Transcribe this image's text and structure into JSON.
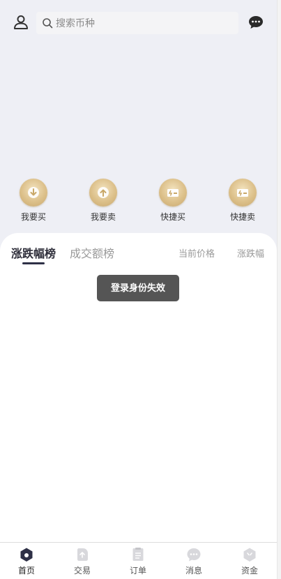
{
  "header": {
    "search_placeholder": "搜索币种"
  },
  "actions": [
    {
      "label": "我要买",
      "icon": "buy-arrow-down-icon"
    },
    {
      "label": "我要卖",
      "icon": "sell-arrow-up-icon"
    },
    {
      "label": "快捷买",
      "icon": "quick-buy-card-icon"
    },
    {
      "label": "快捷卖",
      "icon": "quick-sell-card-icon"
    }
  ],
  "rank_tabs": [
    "涨跌幅榜",
    "成交额榜"
  ],
  "columns": {
    "price": "当前价格",
    "change": "涨跌幅"
  },
  "toast": "登录身份失效",
  "tabbar": [
    {
      "label": "首页",
      "icon": "home-icon",
      "active": true
    },
    {
      "label": "交易",
      "icon": "trade-icon"
    },
    {
      "label": "订单",
      "icon": "order-icon"
    },
    {
      "label": "消息",
      "icon": "message-icon"
    },
    {
      "label": "资金",
      "icon": "assets-icon"
    }
  ],
  "colors": {
    "accent": "#2e3046",
    "gold": "#d6b97f",
    "background": "#eeeff5"
  }
}
